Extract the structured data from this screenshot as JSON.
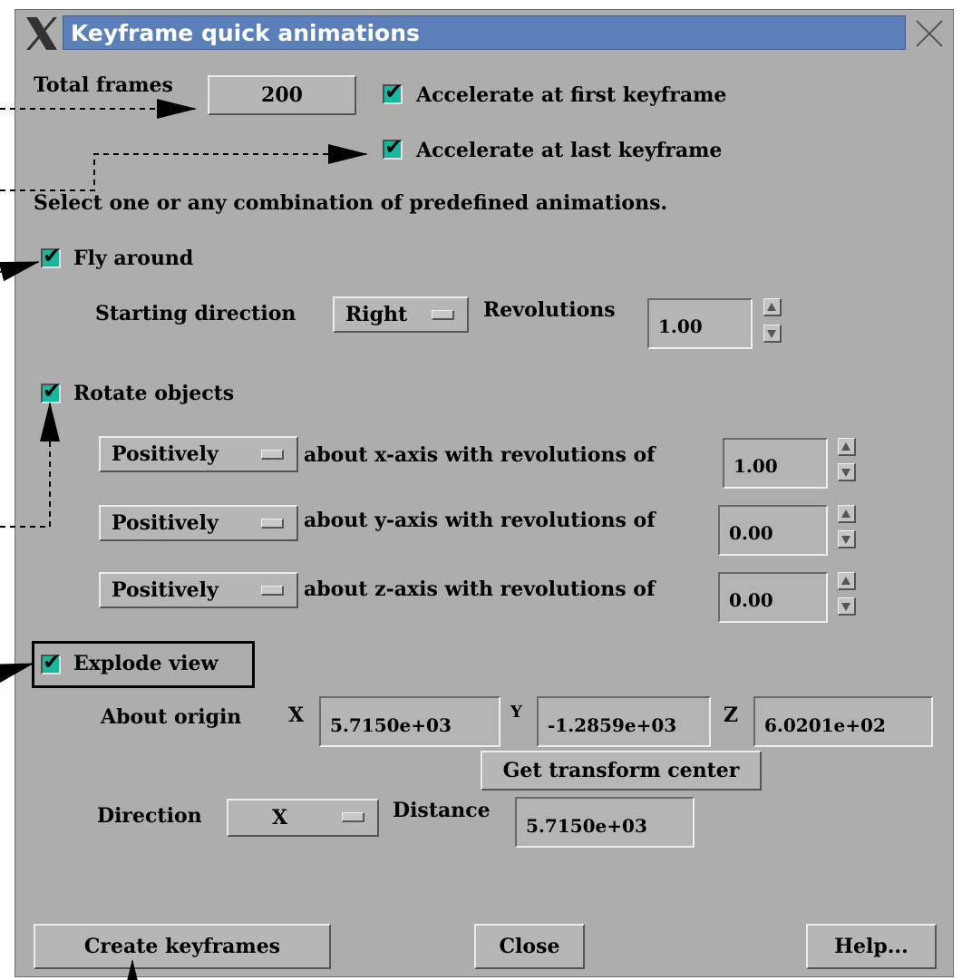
{
  "window": {
    "title": "Keyframe quick animations"
  },
  "total_frames": {
    "label": "Total frames",
    "value": "200"
  },
  "accelerate_first": {
    "label": "Accelerate at first keyframe",
    "checked": true
  },
  "accelerate_last": {
    "label": "Accelerate at last keyframe",
    "checked": true
  },
  "instructions": "Select one or any combination of predefined animations.",
  "fly_around": {
    "label": "Fly around",
    "checked": true,
    "starting_direction_label": "Starting direction",
    "starting_direction_value": "Right",
    "revolutions_label": "Revolutions",
    "revolutions_value": "1.00"
  },
  "rotate_objects": {
    "label": "Rotate objects",
    "checked": true,
    "rows": [
      {
        "direction": "Positively",
        "text": "about x-axis with revolutions of",
        "value": "1.00"
      },
      {
        "direction": "Positively",
        "text": "about y-axis with revolutions of",
        "value": "0.00"
      },
      {
        "direction": "Positively",
        "text": "about z-axis with revolutions of",
        "value": "0.00"
      }
    ]
  },
  "explode_view": {
    "label": "Explode view",
    "checked": true,
    "about_origin_label": "About origin",
    "x_label": "X",
    "x_value": "5.7150e+03",
    "y_label": "Y",
    "y_value": "-1.2859e+03",
    "z_label": "Z",
    "z_value": "6.0201e+02",
    "get_center_label": "Get transform center",
    "direction_label": "Direction",
    "direction_value": "X",
    "distance_label": "Distance",
    "distance_value": "5.7150e+03"
  },
  "buttons": {
    "create": "Create keyframes",
    "close": "Close",
    "help": "Help..."
  },
  "colors": {
    "panel": "#adadad",
    "title_bar": "#5b7fb8",
    "checkbox": "#17b8a0"
  }
}
